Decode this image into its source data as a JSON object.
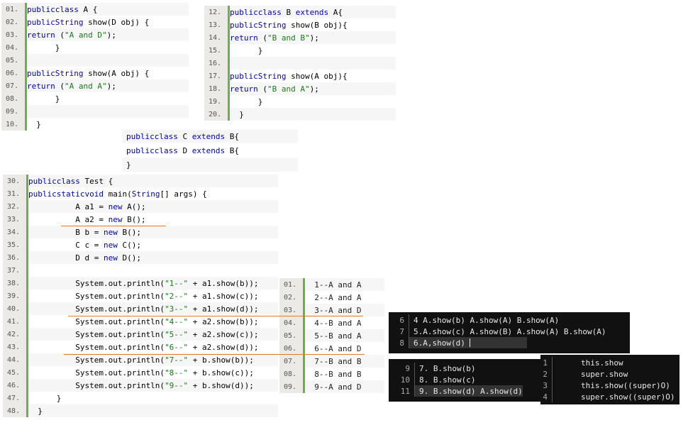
{
  "blockA": {
    "lines": [
      {
        "n": "01.",
        "t": "public class A {"
      },
      {
        "n": "02.",
        "t": "    public String show(D obj) {"
      },
      {
        "n": "03.",
        "t": "        return (\"A and D\");"
      },
      {
        "n": "04.",
        "t": "    }"
      },
      {
        "n": "05.",
        "t": ""
      },
      {
        "n": "06.",
        "t": "    public String show(A obj) {"
      },
      {
        "n": "07.",
        "t": "        return (\"A and A\");"
      },
      {
        "n": "08.",
        "t": "    }"
      },
      {
        "n": "09.",
        "t": ""
      },
      {
        "n": "10.",
        "t": "}"
      }
    ]
  },
  "blockB": {
    "lines": [
      {
        "n": "12.",
        "t": "public class B extends A{"
      },
      {
        "n": "13.",
        "t": "    public String show(B obj){"
      },
      {
        "n": "14.",
        "t": "        return (\"B and B\");"
      },
      {
        "n": "15.",
        "t": "    }"
      },
      {
        "n": "16.",
        "t": ""
      },
      {
        "n": "17.",
        "t": "    public String show(A obj){"
      },
      {
        "n": "18.",
        "t": "        return (\"B and A\");"
      },
      {
        "n": "19.",
        "t": "    }"
      },
      {
        "n": "20.",
        "t": "}"
      }
    ]
  },
  "blockCD": {
    "lines": [
      "public class C extends B{",
      "public class D extends B{",
      "}"
    ]
  },
  "blockTest": {
    "lines": [
      {
        "n": "30.",
        "t": "public class Test {"
      },
      {
        "n": "31.",
        "t": "    public static void main(String[] args) {"
      },
      {
        "n": "32.",
        "t": "        A a1 = new A();"
      },
      {
        "n": "33.",
        "t": "        A a2 = new B();"
      },
      {
        "n": "34.",
        "t": "        B b = new B();"
      },
      {
        "n": "35.",
        "t": "        C c = new C();"
      },
      {
        "n": "36.",
        "t": "        D d = new D();"
      },
      {
        "n": "37.",
        "t": ""
      },
      {
        "n": "38.",
        "t": "        System.out.println(\"1--\" + a1.show(b));"
      },
      {
        "n": "39.",
        "t": "        System.out.println(\"2--\" + a1.show(c));"
      },
      {
        "n": "40.",
        "t": "        System.out.println(\"3--\" + a1.show(d));"
      },
      {
        "n": "41.",
        "t": "        System.out.println(\"4--\" + a2.show(b));"
      },
      {
        "n": "42.",
        "t": "        System.out.println(\"5--\" + a2.show(c));"
      },
      {
        "n": "43.",
        "t": "        System.out.println(\"6--\" + a2.show(d));"
      },
      {
        "n": "44.",
        "t": "        System.out.println(\"7--\" + b.show(b));"
      },
      {
        "n": "45.",
        "t": "        System.out.println(\"8--\" + b.show(c));"
      },
      {
        "n": "46.",
        "t": "        System.out.println(\"9--\" + b.show(d));"
      },
      {
        "n": "47.",
        "t": "    }"
      },
      {
        "n": "48.",
        "t": "}"
      }
    ]
  },
  "output": {
    "lines": [
      {
        "n": "01.",
        "t": "1--A and A"
      },
      {
        "n": "02.",
        "t": "2--A and A"
      },
      {
        "n": "03.",
        "t": "3--A and D"
      },
      {
        "n": "04.",
        "t": "4--B and A"
      },
      {
        "n": "05.",
        "t": "5--B and A"
      },
      {
        "n": "06.",
        "t": "6--A and D"
      },
      {
        "n": "07.",
        "t": "7--B and B"
      },
      {
        "n": "08.",
        "t": "8--B and B"
      },
      {
        "n": "09.",
        "t": "9--A and D"
      }
    ]
  },
  "notes1": {
    "lines": [
      {
        "n": "6",
        "t": "4 A.show(b) A.show(A) B.show(A)"
      },
      {
        "n": "7",
        "t": "5.A.show(c) A.show(B) A.show(A) B.show(A)"
      },
      {
        "n": "8",
        "t": "6.A,show(d)"
      }
    ]
  },
  "notes2": {
    "lines": [
      {
        "n": "9",
        "t": "7. B.show(b)"
      },
      {
        "n": "10",
        "t": "8. B.show(c)"
      },
      {
        "n": "11",
        "t": "9. B.show(d) A.show(d)"
      }
    ]
  },
  "notes3": {
    "lines": [
      {
        "n": "1",
        "t": "this.show"
      },
      {
        "n": "2",
        "t": "super.show"
      },
      {
        "n": "3",
        "t": "this.show((super)O)"
      },
      {
        "n": "4",
        "t": "super.show((super)O)"
      }
    ]
  },
  "colors": {
    "keyword": "#0000aa",
    "string": "#1a7a1a",
    "gutter": "#6ab04c",
    "annotation": "#e07b20"
  }
}
